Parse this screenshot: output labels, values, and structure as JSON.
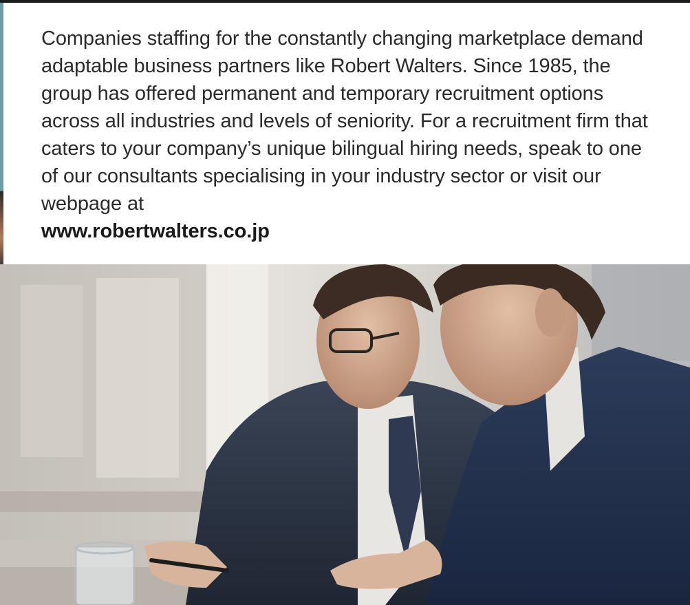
{
  "paragraph": {
    "text": "Companies staffing for the constantly changing marketplace demand adaptable business partners like Robert Walters. Since 1985, the group has offered permanent and temporary recruitment options across all industries and levels of seniority. For a recruitment firm that caters to your company’s unique bilingual hiring needs, speak to one of our consultants specialising in your industry sector or visit our webpage at",
    "url": "www.robertwalters.co.jp"
  },
  "photo": {
    "subject": "two-businessmen-reviewing-document"
  },
  "colors": {
    "text": "#2a2a2a",
    "top_bar": "#1d1c1c",
    "left_edge": "#6f9aa6"
  }
}
